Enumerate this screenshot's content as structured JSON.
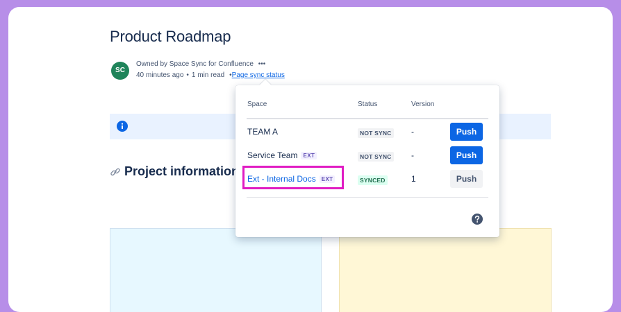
{
  "page": {
    "title": "Product Roadmap",
    "owner_line": "Owned by Space Sync for Confluence",
    "more_glyph": "•••",
    "time_ago": "40 minutes ago",
    "separator": "•",
    "read_time": "1 min read",
    "sync_link_prefix": "•",
    "sync_status_link": "Page sync status",
    "section_heading": "Project information"
  },
  "avatar": {
    "initials": "SC",
    "color": "#1f845a"
  },
  "popup": {
    "headers": {
      "space": "Space",
      "status": "Status",
      "version": "Version"
    },
    "rows": [
      {
        "space": "TEAM A",
        "ext": "",
        "status": "NOT SYNC",
        "version": "-",
        "button": "Push"
      },
      {
        "space": "Service Team",
        "ext": "EXT",
        "status": "NOT SYNC",
        "version": "-",
        "button": "Push"
      },
      {
        "space": "Ext - Internal Docs",
        "ext": "EXT",
        "status": "SYNCED",
        "version": "1",
        "button": "Push"
      }
    ],
    "help_icon": "question-circle-icon"
  },
  "icons": {
    "info": "info-circle-icon",
    "link": "link-icon"
  },
  "colors": {
    "accent": "#0c66e4",
    "highlight": "#e01cc3",
    "frame_border": "#b78ee8",
    "synced": "#216e4e"
  }
}
